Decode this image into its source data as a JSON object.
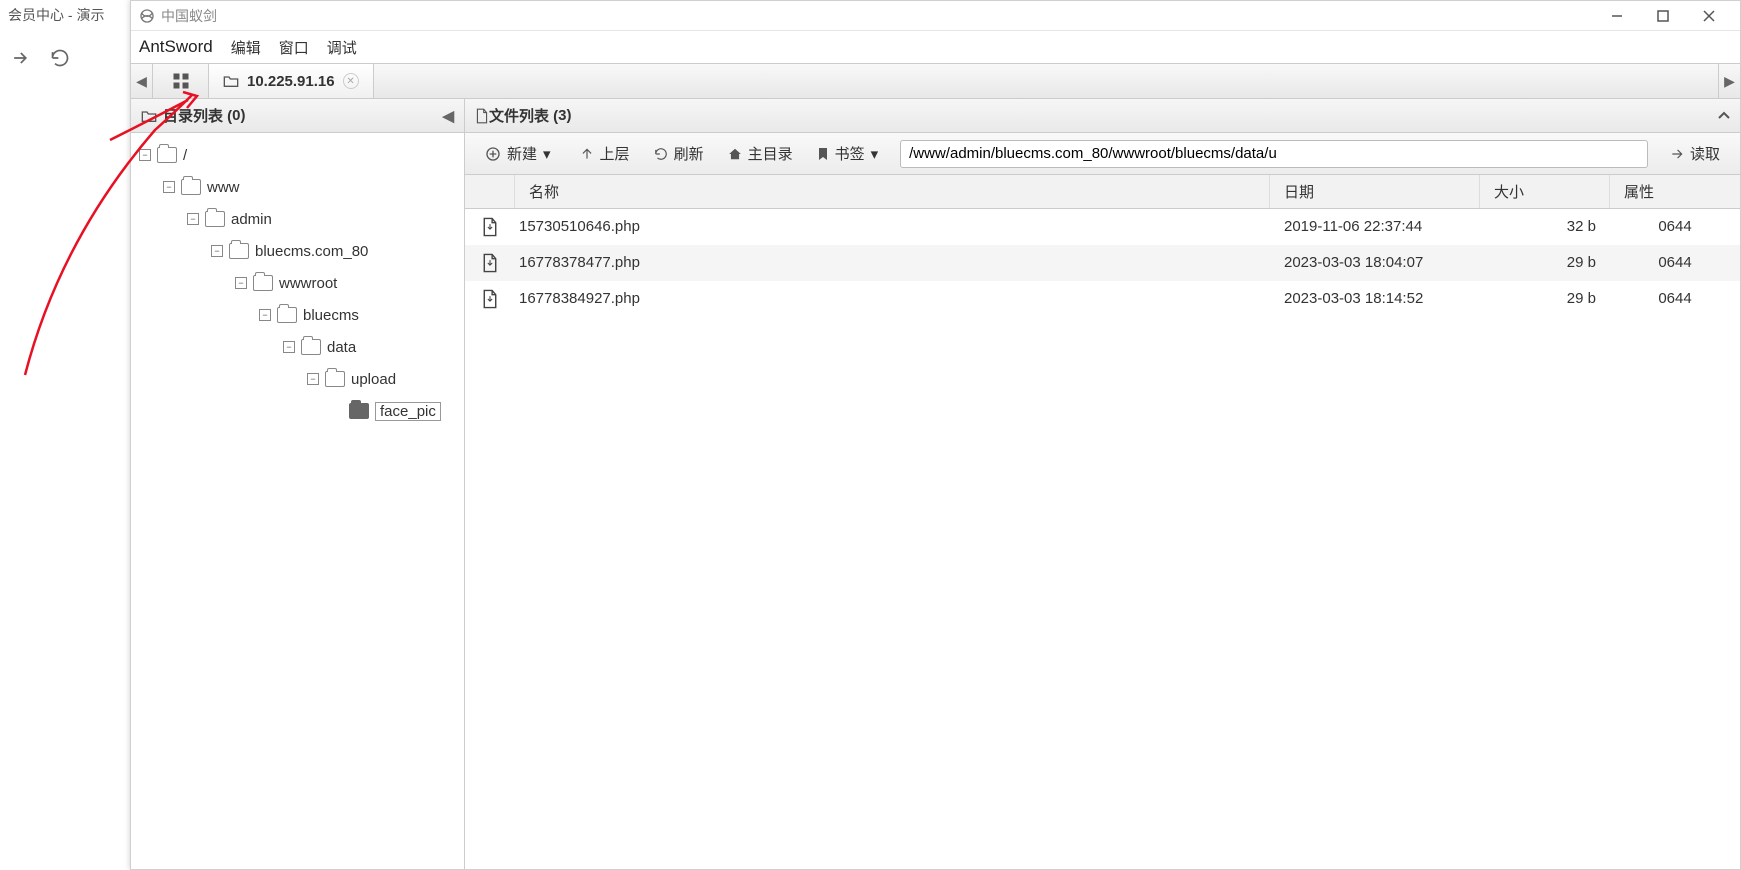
{
  "browser": {
    "tab_title": "会员中心 - 演示"
  },
  "window": {
    "title": "中国蚁剑",
    "brand": "AntSword",
    "menus": {
      "edit": "编辑",
      "window": "窗口",
      "debug": "调试"
    },
    "tab": {
      "ip": "10.225.91.16"
    }
  },
  "left": {
    "header_prefix": "目录列表 (",
    "header_count": "0",
    "header_suffix": ")",
    "tree": {
      "root": "/",
      "n1": "www",
      "n2": "admin",
      "n3": "bluecms.com_80",
      "n4": "wwwroot",
      "n5": "bluecms",
      "n6": "data",
      "n7": "upload",
      "n8": "face_pic"
    }
  },
  "right": {
    "header_prefix": "文件列表 (",
    "header_count": "3",
    "header_suffix": ")",
    "toolbar": {
      "new": "新建",
      "up": "上层",
      "refresh": "刷新",
      "home": "主目录",
      "bookmark": "书签",
      "read": "读取",
      "path": "/www/admin/bluecms.com_80/wwwroot/bluecms/data/u"
    },
    "cols": {
      "name": "名称",
      "date": "日期",
      "size": "大小",
      "attr": "属性"
    },
    "rows": [
      {
        "name": "15730510646.php",
        "date": "2019-11-06 22:37:44",
        "size": "32 b",
        "attr": "0644"
      },
      {
        "name": "16778378477.php",
        "date": "2023-03-03 18:04:07",
        "size": "29 b",
        "attr": "0644"
      },
      {
        "name": "16778384927.php",
        "date": "2023-03-03 18:14:52",
        "size": "29 b",
        "attr": "0644"
      }
    ]
  }
}
